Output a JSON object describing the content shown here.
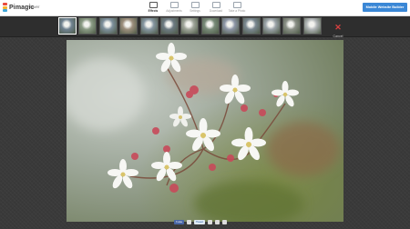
{
  "header": {
    "brand": "Pimagic",
    "brand_sub": "Flower",
    "mobile_button_label": "Mobile Website Builder",
    "tools": [
      {
        "label": "Effects",
        "icon": "effects-icon",
        "active": true
      },
      {
        "label": "Adjustments",
        "icon": "adjustments-icon",
        "active": false
      },
      {
        "label": "Settings",
        "icon": "settings-icon",
        "active": false
      },
      {
        "label": "Download",
        "icon": "download-icon",
        "active": false
      },
      {
        "label": "Take a Photo",
        "icon": "camera-icon",
        "active": false
      }
    ]
  },
  "filmstrip": {
    "cancel_label": "Cancel",
    "thumbnail_count": 13
  },
  "share": {
    "facebook": "f Like",
    "twitter": "Tweet"
  },
  "colors": {
    "accent": "#3a87d6",
    "cancel": "#d84040",
    "background": "#3a3a3a"
  }
}
